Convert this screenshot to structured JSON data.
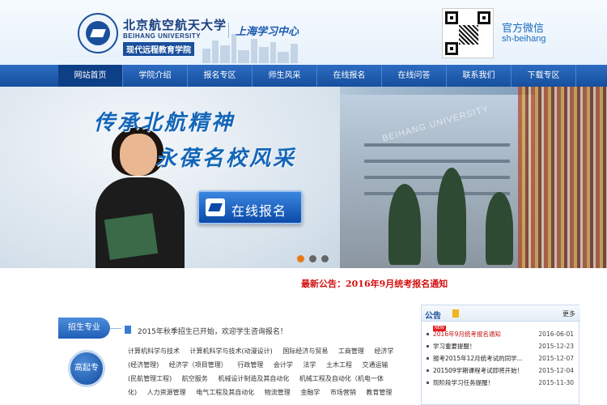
{
  "header": {
    "logo_cn": "北京航空航天大学",
    "logo_en": "BEIHANG UNIVERSITY",
    "school": "现代远程教育学院",
    "center": "上海学习中心",
    "wechat_title": "官方微信",
    "wechat_id": "sh-beihang"
  },
  "nav": {
    "items": [
      "网站首页",
      "学院介绍",
      "报名专区",
      "师生风采",
      "在线报名",
      "在线问答",
      "联系我们",
      "下载专区"
    ]
  },
  "banner": {
    "slogan1": "传承北航精神",
    "slogan2": "永葆名校风采",
    "campus_text": "BEIHANG UNIVERSITY",
    "signup_button": "在线报名"
  },
  "announcement": "最新公告：2016年9月统考报名通知",
  "majors": {
    "tab": "招生专业",
    "notice": "2015年秋季招生已开始，欢迎学生咨询报名！",
    "level": "高起专",
    "rows": [
      [
        "计算机科学与技术",
        "计算机科学与技术(动漫设计)",
        "国际经济与贸易",
        "工商管理",
        "经济学"
      ],
      [
        "(经济管理)",
        "经济学（项目管理）",
        "行政管理",
        "会计学",
        "法学",
        "土木工程",
        "交通运输"
      ],
      [
        "(民航管理工程)",
        "航空服务",
        "机械设计制造及其自动化",
        "机械工程及自动化（机电一体"
      ],
      [
        "化)",
        "人力资源管理",
        "电气工程及其自动化",
        "物流管理",
        "金融学",
        "市场营销",
        "教育管理"
      ]
    ]
  },
  "notice_panel": {
    "title": "公告",
    "more": "更多",
    "new_badge": "NEW",
    "items": [
      {
        "text": "2016年9月统考报名通知",
        "date": "2016-06-01"
      },
      {
        "text": "学习重要提醒！",
        "date": "2015-12-23"
      },
      {
        "text": "报考2015年12月统考试的同学...",
        "date": "2015-12-07"
      },
      {
        "text": "201509学期课程考试即将开始！",
        "date": "2015-12-04"
      },
      {
        "text": "现阶段学习任务提醒！",
        "date": "2015-11-30"
      }
    ]
  }
}
